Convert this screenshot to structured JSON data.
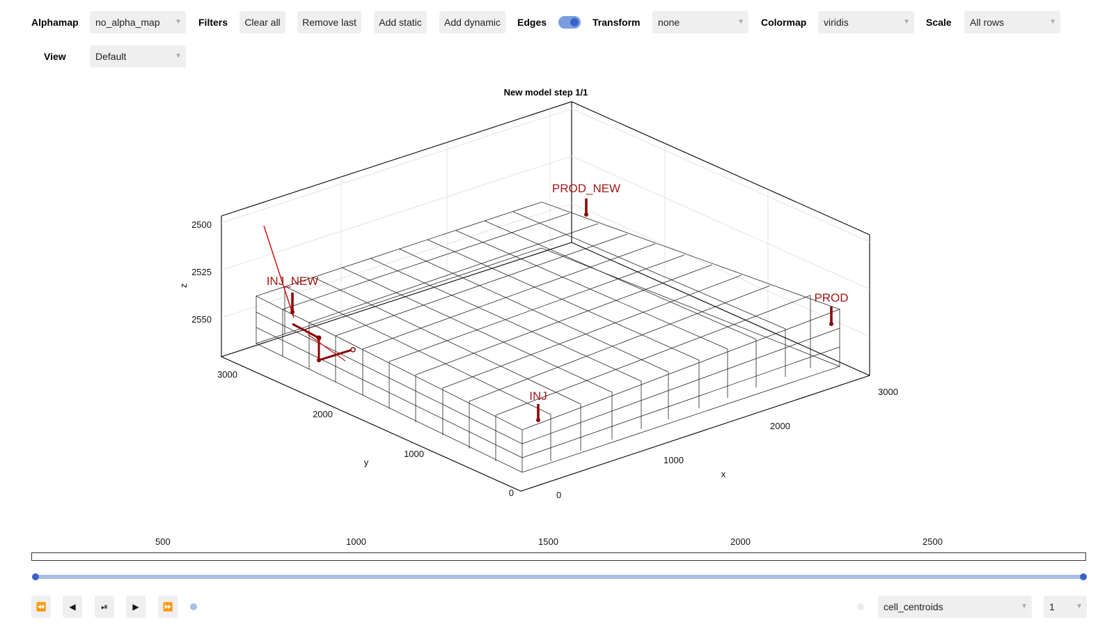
{
  "toolbar": {
    "alphamap_label": "Alphamap",
    "alphamap_value": "no_alpha_map",
    "filters_label": "Filters",
    "clear_all": "Clear all",
    "remove_last": "Remove last",
    "add_static": "Add static",
    "add_dynamic": "Add dynamic",
    "edges_label": "Edges",
    "edges_on": true,
    "transform_label": "Transform",
    "transform_value": "none",
    "colormap_label": "Colormap",
    "colormap_value": "viridis",
    "scale_label": "Scale",
    "scale_value": "All rows",
    "view_label": "View",
    "view_value": "Default"
  },
  "plot": {
    "title": "New model step 1/1",
    "z_axis": {
      "label": "z",
      "ticks": [
        "2500",
        "2525",
        "2550"
      ]
    },
    "y_axis": {
      "label": "y",
      "ticks": [
        "3000",
        "2000",
        "1000",
        "0"
      ]
    },
    "x_axis": {
      "label": "x",
      "ticks": [
        "0",
        "1000",
        "2000",
        "3000"
      ]
    },
    "wells": [
      "PROD_NEW",
      "INJ_NEW",
      "PROD",
      "INJ"
    ],
    "well_color": "#a01818"
  },
  "range_slider": {
    "ticks": [
      "500",
      "1000",
      "1500",
      "2000",
      "2500"
    ],
    "low": 1,
    "high": 1
  },
  "playback": {
    "icons": [
      "rewind-icon",
      "step-back-icon",
      "play-pause-icon",
      "play-icon",
      "fast-forward-icon"
    ],
    "field_value": "cell_centroids",
    "component_value": "1"
  },
  "colors": {
    "accent": "#3a63c9",
    "track": "#a9bde8",
    "button_bg": "#efefef"
  }
}
